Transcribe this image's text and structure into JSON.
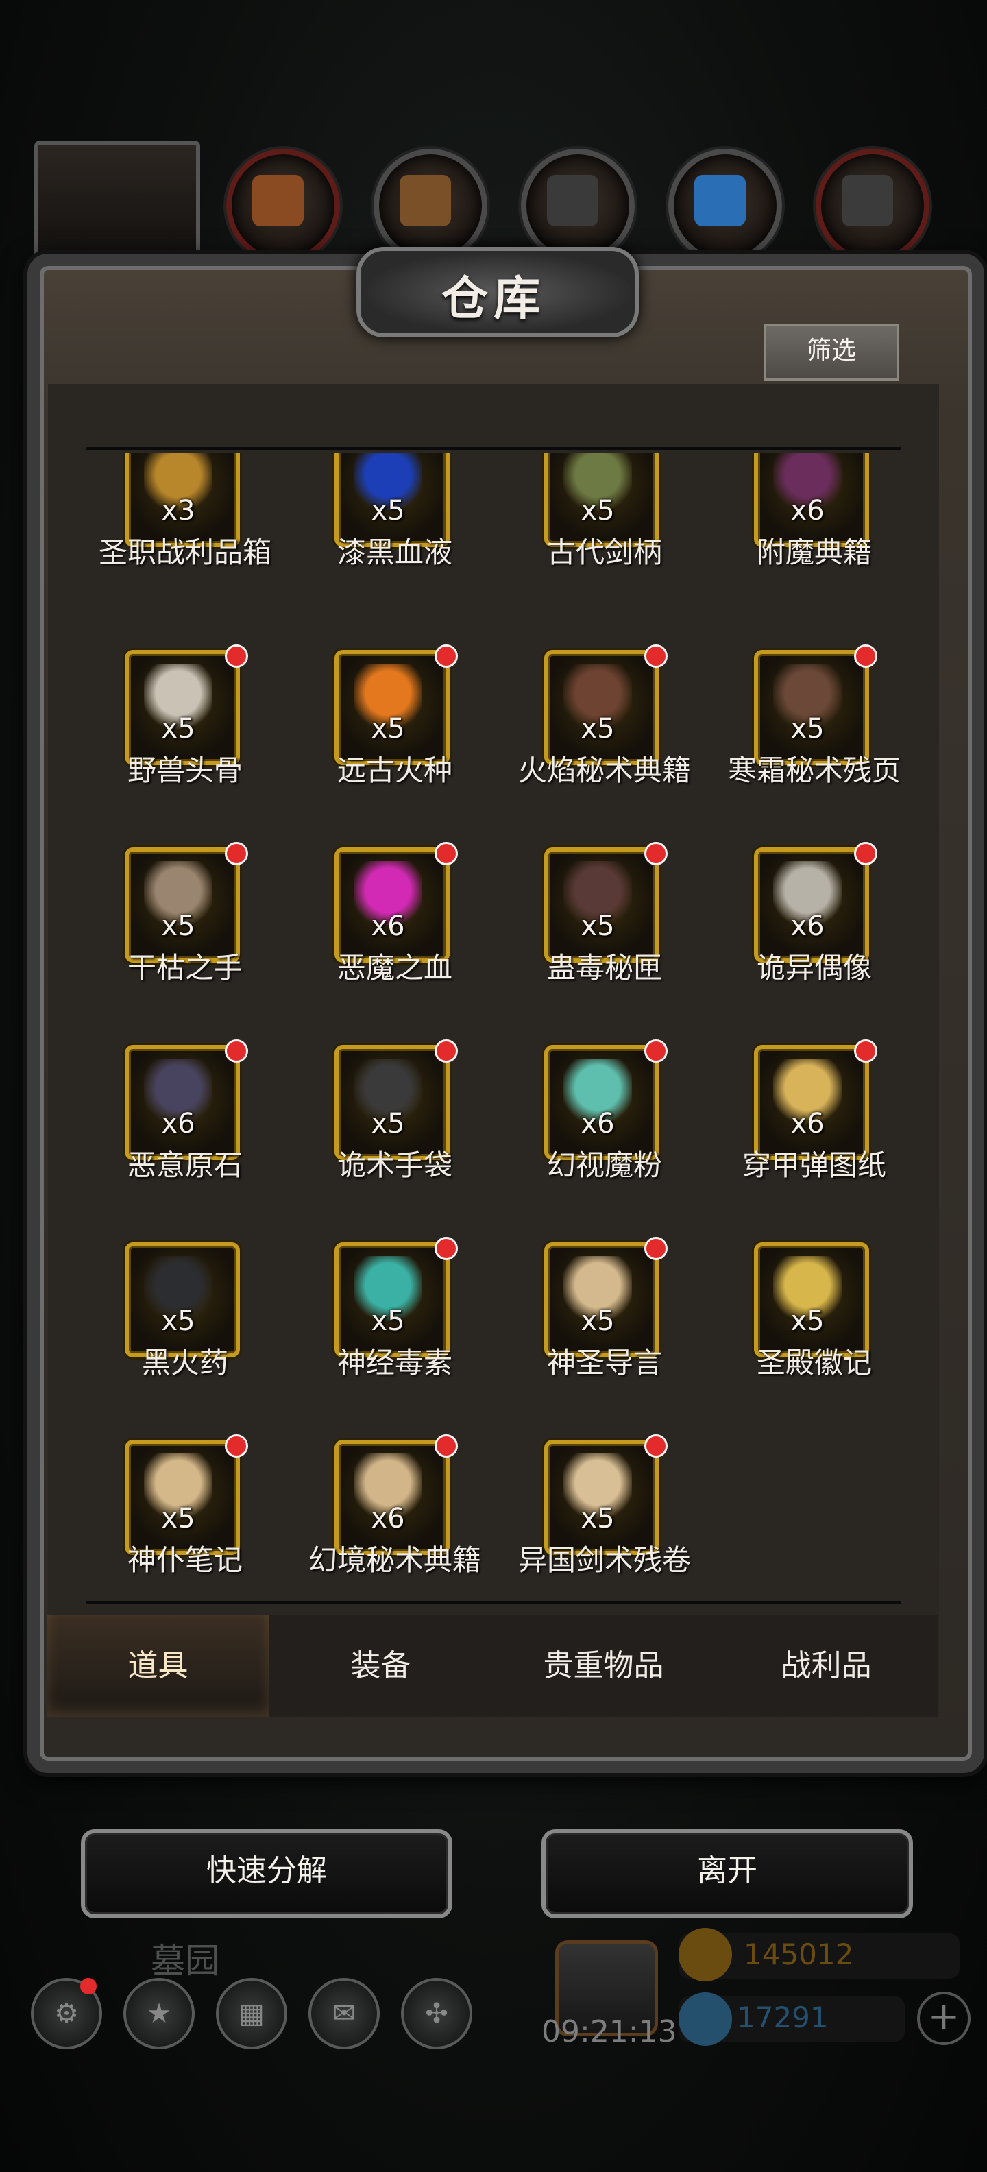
{
  "header": {
    "title": "仓库",
    "filter_label": "筛选"
  },
  "top_icons": [
    "hero-portrait-icon",
    "hammer-icon",
    "wood-plank-icon",
    "ingot-icon",
    "crystal-icon",
    "metal-bar-icon"
  ],
  "items": [
    {
      "name": "圣职战利品箱",
      "qty": "x3",
      "icon": "chest-icon",
      "color": "#b8862b",
      "new": false
    },
    {
      "name": "漆黑血液",
      "qty": "x5",
      "icon": "blue-drop-icon",
      "color": "#1c3fb8",
      "new": true
    },
    {
      "name": "古代剑柄",
      "qty": "x5",
      "icon": "sword-hilt-icon",
      "color": "#6d7a43",
      "new": true
    },
    {
      "name": "附魔典籍",
      "qty": "x6",
      "icon": "purple-book-icon",
      "color": "#6a2d5c",
      "new": true
    },
    {
      "name": "野兽头骨",
      "qty": "x5",
      "icon": "skull-icon",
      "color": "#c9c2b5",
      "new": true
    },
    {
      "name": "远古火种",
      "qty": "x5",
      "icon": "flame-icon",
      "color": "#e3781e",
      "new": true
    },
    {
      "name": "火焰秘术典籍",
      "qty": "x5",
      "icon": "brown-book-icon",
      "color": "#6e4332",
      "new": true
    },
    {
      "name": "寒霜秘术残页",
      "qty": "x5",
      "icon": "brown-book-icon",
      "color": "#6b4838",
      "new": true
    },
    {
      "name": "干枯之手",
      "qty": "x5",
      "icon": "withered-hand-icon",
      "color": "#9a8570",
      "new": true
    },
    {
      "name": "恶魔之血",
      "qty": "x6",
      "icon": "pink-drop-icon",
      "color": "#d22ab5",
      "new": true
    },
    {
      "name": "蛊毒秘匣",
      "qty": "x5",
      "icon": "cursed-box-icon",
      "color": "#5a3a37",
      "new": true
    },
    {
      "name": "诡异偶像",
      "qty": "x6",
      "icon": "idol-icon",
      "color": "#b7b2a8",
      "new": true
    },
    {
      "name": "恶意原石",
      "qty": "x6",
      "icon": "ore-icon",
      "color": "#48435e",
      "new": true
    },
    {
      "name": "诡术手袋",
      "qty": "x5",
      "icon": "pouch-icon",
      "color": "#3a3a3a",
      "new": true
    },
    {
      "name": "幻视魔粉",
      "qty": "x6",
      "icon": "powder-icon",
      "color": "#5ebfae",
      "new": true
    },
    {
      "name": "穿甲弹图纸",
      "qty": "x6",
      "icon": "scroll-icon",
      "color": "#d8b35a",
      "new": true
    },
    {
      "name": "黑火药",
      "qty": "x5",
      "icon": "black-powder-icon",
      "color": "#2c2d30",
      "new": false
    },
    {
      "name": "神经毒素",
      "qty": "x5",
      "icon": "flask-icon",
      "color": "#3bb1a5",
      "new": true
    },
    {
      "name": "神圣导言",
      "qty": "x5",
      "icon": "parchment-icon",
      "color": "#d4b98e",
      "new": true
    },
    {
      "name": "圣殿徽记",
      "qty": "x5",
      "icon": "emblem-icon",
      "color": "#d7b64b",
      "new": false
    },
    {
      "name": "神仆笔记",
      "qty": "x5",
      "icon": "parchment-icon",
      "color": "#d5b88a",
      "new": true
    },
    {
      "name": "幻境秘术典籍",
      "qty": "x6",
      "icon": "parchment-icon",
      "color": "#d2b589",
      "new": true
    },
    {
      "name": "异国剑术残卷",
      "qty": "x5",
      "icon": "rolled-scroll-icon",
      "color": "#d9bf95",
      "new": true
    }
  ],
  "tabs": [
    "道具",
    "装备",
    "贵重物品",
    "战利品"
  ],
  "active_tab": 0,
  "buttons": {
    "quick_salvage": "快速分解",
    "leave": "离开"
  },
  "footer": {
    "location": "墓园",
    "timer": "09:21:13",
    "gold": "145012",
    "gems": "17291",
    "gold_color": "#6b4c10",
    "gem_color": "#24506e"
  }
}
